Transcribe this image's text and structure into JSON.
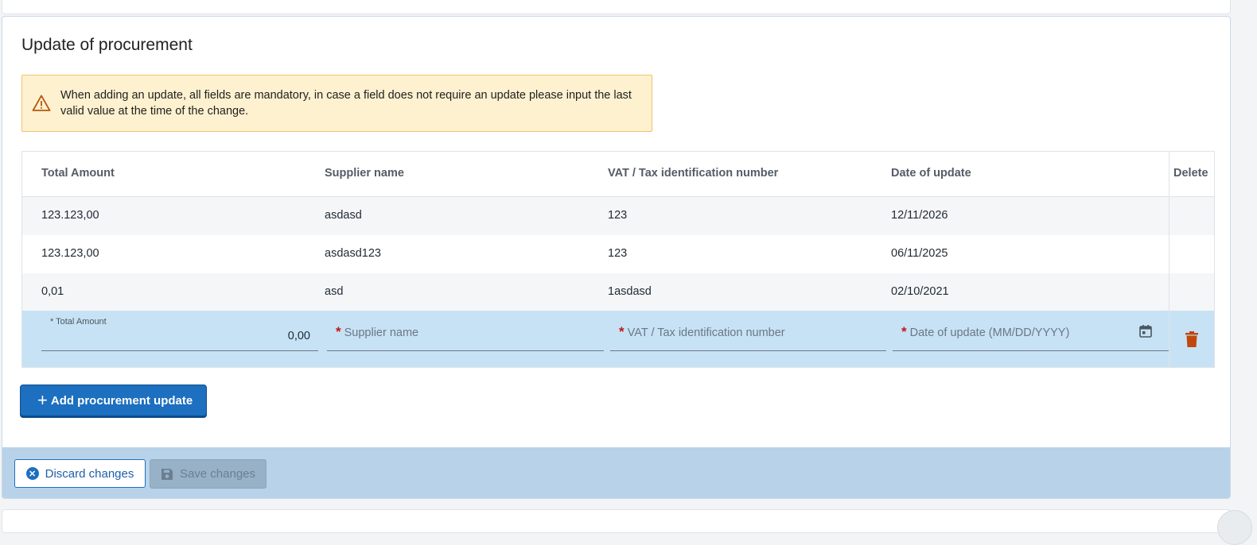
{
  "panel": {
    "title": "Update of procurement",
    "warning": "When adding an update, all fields are mandatory, in case a field does not require an update please input the last valid value at the time of the change."
  },
  "table": {
    "headers": [
      "Total Amount",
      "Supplier name",
      "VAT / Tax identification number",
      "Date of update",
      "Delete"
    ],
    "rows": [
      [
        "123.123,00",
        "asdasd",
        "123",
        "12/11/2026"
      ],
      [
        "123.123,00",
        "asdasd123",
        "123",
        "06/11/2025"
      ],
      [
        "0,01",
        "asd",
        "1asdasd",
        "02/10/2021"
      ]
    ]
  },
  "edit_row": {
    "total_amount_label": "* Total Amount",
    "total_amount_value": "0,00",
    "required_mark": "*",
    "supplier_placeholder": "Supplier name",
    "vat_placeholder": "VAT / Tax identification number",
    "date_placeholder": "Date of update (MM/DD/YYYY)",
    "calendar_icon": "calendar-icon",
    "delete_icon": "trash-icon"
  },
  "actions": {
    "add_label": "Add procurement update",
    "discard_label": "Discard changes",
    "save_label": "Save changes"
  },
  "colors": {
    "primary": "#1d6fbf",
    "warning_bg": "#fdf1cf",
    "edit_row_bg": "#c7e2f5",
    "footer_bg": "#b8d3e9",
    "delete_icon": "#c0480d"
  }
}
